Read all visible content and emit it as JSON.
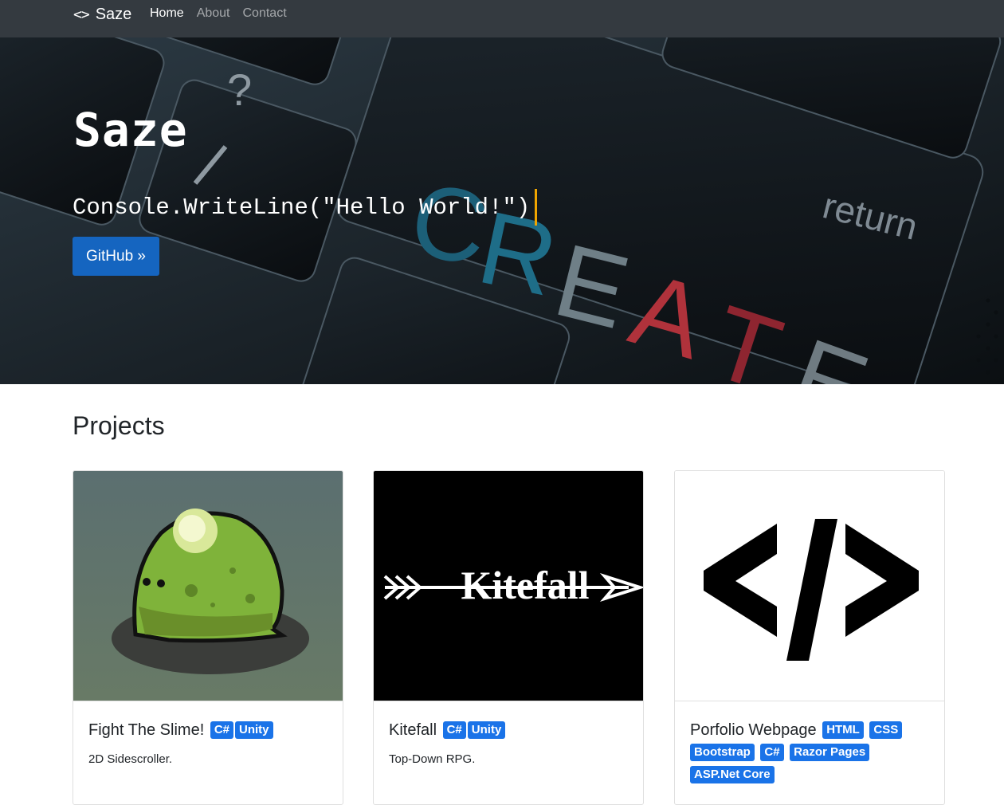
{
  "navbar": {
    "brand_icon": "<>",
    "brand": "Saze",
    "links": [
      {
        "label": "Home",
        "active": true
      },
      {
        "label": "About",
        "active": false
      },
      {
        "label": "Contact",
        "active": false
      }
    ]
  },
  "hero": {
    "title": "Saze",
    "code_line": "Console.WriteLine(\"Hello World!\")",
    "button_label": "GitHub »",
    "background_words": {
      "question": "?",
      "slash": "/",
      "return": "return",
      "create": "CREATE"
    }
  },
  "projects": {
    "heading": "Projects",
    "cards": [
      {
        "title": "Fight The Slime!",
        "badges": [
          "C#",
          "Unity"
        ],
        "description": "2D Sidescroller."
      },
      {
        "title": "Kitefall",
        "badges": [
          "C#",
          "Unity"
        ],
        "description": "Top-Down RPG.",
        "logo_text": "Kitefall"
      },
      {
        "title": "Porfolio Webpage",
        "badges": [
          "HTML",
          "CSS",
          "Bootstrap",
          "C#",
          "Razor Pages",
          "ASP.Net Core"
        ],
        "description": ""
      }
    ]
  },
  "colors": {
    "navbar": "#343a40",
    "button": "#1565c0",
    "badge": "#1a73e8",
    "caret": "#f0a500"
  }
}
